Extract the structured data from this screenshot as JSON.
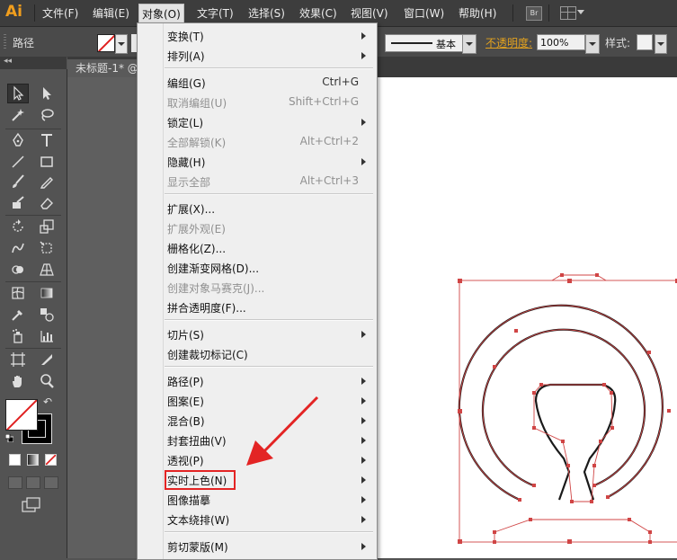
{
  "app": {
    "logo": "Ai",
    "menus": [
      "文件(F)",
      "编辑(E)",
      "对象(O)",
      "文字(T)",
      "选择(S)",
      "效果(C)",
      "视图(V)",
      "窗口(W)",
      "帮助(H)"
    ],
    "active_menu": "对象(O)",
    "bridge_label": "Br"
  },
  "control_bar": {
    "selection_type": "路径",
    "stroke_style": "基本",
    "opacity_label": "不透明度:",
    "opacity_value": "100%",
    "style_label": "样式:"
  },
  "document": {
    "tab_title": "未标题-1* @"
  },
  "object_menu": {
    "items": [
      {
        "label": "变换(T)",
        "shortcut": "",
        "submenu": true,
        "disabled": false
      },
      {
        "label": "排列(A)",
        "shortcut": "",
        "submenu": true,
        "disabled": false
      },
      {
        "label": "编组(G)",
        "shortcut": "Ctrl+G",
        "submenu": false,
        "disabled": false
      },
      {
        "label": "取消编组(U)",
        "shortcut": "Shift+Ctrl+G",
        "submenu": false,
        "disabled": true
      },
      {
        "label": "锁定(L)",
        "shortcut": "",
        "submenu": true,
        "disabled": false
      },
      {
        "label": "全部解锁(K)",
        "shortcut": "Alt+Ctrl+2",
        "submenu": false,
        "disabled": true
      },
      {
        "label": "隐藏(H)",
        "shortcut": "",
        "submenu": true,
        "disabled": false
      },
      {
        "label": "显示全部",
        "shortcut": "Alt+Ctrl+3",
        "submenu": false,
        "disabled": true
      },
      {
        "label": "扩展(X)...",
        "shortcut": "",
        "submenu": false,
        "disabled": false
      },
      {
        "label": "扩展外观(E)",
        "shortcut": "",
        "submenu": false,
        "disabled": true
      },
      {
        "label": "栅格化(Z)...",
        "shortcut": "",
        "submenu": false,
        "disabled": false
      },
      {
        "label": "创建渐变网格(D)...",
        "shortcut": "",
        "submenu": false,
        "disabled": false
      },
      {
        "label": "创建对象马赛克(J)...",
        "shortcut": "",
        "submenu": false,
        "disabled": true
      },
      {
        "label": "拼合透明度(F)...",
        "shortcut": "",
        "submenu": false,
        "disabled": false
      },
      {
        "label": "切片(S)",
        "shortcut": "",
        "submenu": true,
        "disabled": false
      },
      {
        "label": "创建裁切标记(C)",
        "shortcut": "",
        "submenu": false,
        "disabled": false
      },
      {
        "label": "路径(P)",
        "shortcut": "",
        "submenu": true,
        "disabled": false
      },
      {
        "label": "图案(E)",
        "shortcut": "",
        "submenu": true,
        "disabled": false
      },
      {
        "label": "混合(B)",
        "shortcut": "",
        "submenu": true,
        "disabled": false
      },
      {
        "label": "封套扭曲(V)",
        "shortcut": "",
        "submenu": true,
        "disabled": false
      },
      {
        "label": "透视(P)",
        "shortcut": "",
        "submenu": true,
        "disabled": false
      },
      {
        "label": "实时上色(N)",
        "shortcut": "",
        "submenu": true,
        "disabled": false
      },
      {
        "label": "图像描摹",
        "shortcut": "",
        "submenu": true,
        "disabled": false
      },
      {
        "label": "文本绕排(W)",
        "shortcut": "",
        "submenu": true,
        "disabled": false
      },
      {
        "label": "剪切蒙版(M)",
        "shortcut": "",
        "submenu": true,
        "disabled": false
      }
    ],
    "highlighted_item": "实时上色(N)"
  },
  "colors": {
    "accent_orange": "#e2a11f",
    "annotation_red": "#e32424",
    "selection_path": "#d04545"
  }
}
